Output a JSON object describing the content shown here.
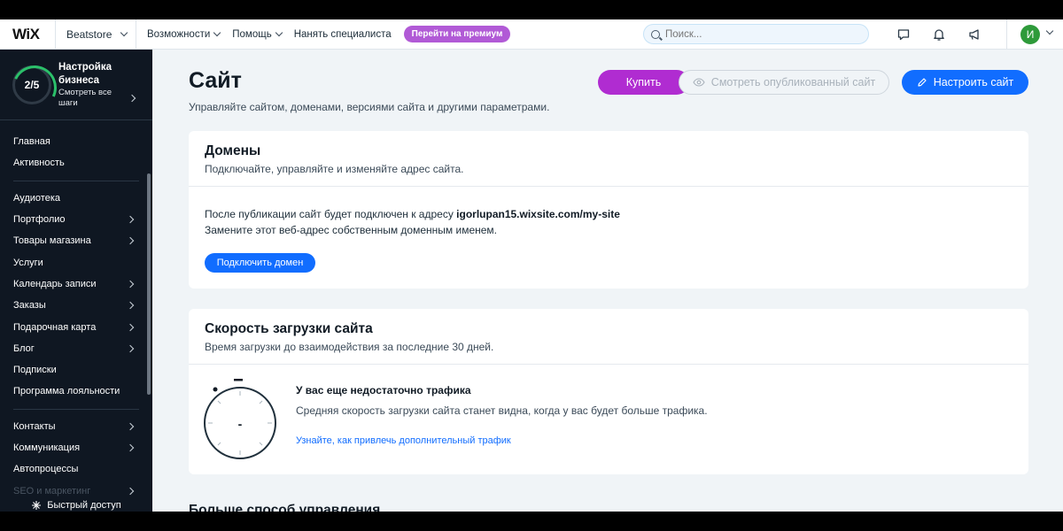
{
  "topbar": {
    "logo": "WiX",
    "site_name": "Beatstore",
    "nav": [
      {
        "label": "Возможности"
      },
      {
        "label": "Помощь"
      },
      {
        "label": "Нанять специалиста"
      }
    ],
    "premium_label": "Перейти на премиум",
    "search_placeholder": "Поиск...",
    "avatar_letter": "И",
    "icons": [
      "chat-icon",
      "bell-icon",
      "megaphone-icon"
    ]
  },
  "sidebar": {
    "setup_progress": "2/5",
    "setup_progress_value": 0.4,
    "setup_title": "Настройка бизнеса",
    "setup_sub": "Смотреть все шаги",
    "groups": [
      [
        {
          "label": "Главная",
          "chevron": false
        },
        {
          "label": "Активность",
          "chevron": false
        }
      ],
      [
        {
          "label": "Аудиотека",
          "chevron": false
        },
        {
          "label": "Портфолио",
          "chevron": true
        },
        {
          "label": "Товары магазина",
          "chevron": true
        },
        {
          "label": "Услуги",
          "chevron": false
        },
        {
          "label": "Календарь записи",
          "chevron": true
        },
        {
          "label": "Заказы",
          "chevron": true
        },
        {
          "label": "Подарочная карта",
          "chevron": true
        },
        {
          "label": "Блог",
          "chevron": true
        },
        {
          "label": "Подписки",
          "chevron": false
        },
        {
          "label": "Программа лояльности",
          "chevron": false
        }
      ],
      [
        {
          "label": "Контакты",
          "chevron": true
        },
        {
          "label": "Коммуникация",
          "chevron": true
        },
        {
          "label": "Автопроцессы",
          "chevron": false
        },
        {
          "label": "SEO и маркетинг",
          "chevron": true,
          "faded": true
        }
      ]
    ],
    "quick_access": "Быстрый доступ"
  },
  "main": {
    "title": "Сайт",
    "subtitle": "Управляйте сайтом, доменами, версиями сайта и другими параметрами.",
    "buttons": {
      "buy": "Купить",
      "view_published": "Смотреть опубликованный сайт",
      "edit_site": "Настроить сайт"
    },
    "domains": {
      "title": "Домены",
      "desc": "Подключайте, управляйте и изменяйте адрес сайта.",
      "line1_prefix": "После публикации сайт будет подключен к адресу ",
      "domain": "igorlupan15.wixsite.com/my-site",
      "line2": "Замените этот веб-адрес собственным доменным именем.",
      "connect_button": "Подключить домен"
    },
    "speed": {
      "title": "Скорость загрузки сайта",
      "desc": "Время загрузки до взаимодействия за последние 30 дней.",
      "gauge_value": "-",
      "no_traffic_title": "У вас еще недостаточно трафика",
      "no_traffic_desc": "Средняя скорость загрузки сайта станет видна, когда у вас будет больше трафика.",
      "link": "Узнайте, как привлечь дополнительный трафик"
    },
    "more_title": "Больше способ управления"
  },
  "colors": {
    "accent_blue": "#116dff",
    "purple": "#b02cd1",
    "premium": "#b15ad6",
    "sidebar_bg": "#0f1722",
    "progress_green": "#2bc06a"
  }
}
